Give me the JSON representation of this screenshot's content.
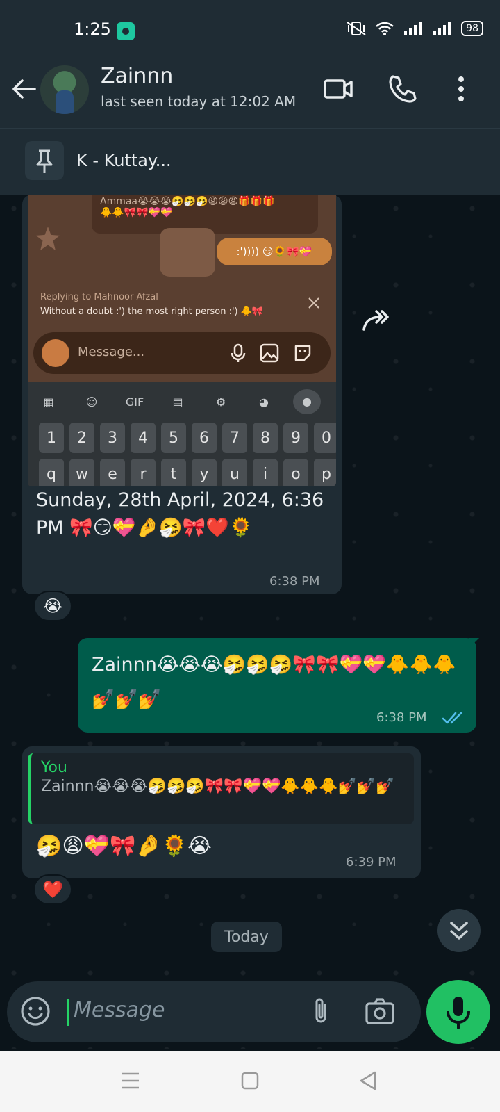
{
  "status": {
    "time": "1:25",
    "battery": "98"
  },
  "header": {
    "name": "Zainnn",
    "last_seen": "last seen today at 12:02 AM"
  },
  "pinned": {
    "text": "K - Kuttay..."
  },
  "shot": {
    "top_message": "Ammaa😭😭😭🤧🤧🤧😩😩😩🎁🎁🎁",
    "top_message_2": "🐥🐥🎀🎀💝💝",
    "bubble": ":')))) 😏🌻🎀💝",
    "reply_title": "Replying to Mahnoor Afzal",
    "reply_body": "Without a doubt :') the most right person :') 🐥🎀",
    "input_placeholder": "Message...",
    "gif_label": "GIF",
    "keys_row1": [
      "1",
      "2",
      "3",
      "4",
      "5",
      "6",
      "7",
      "8",
      "9",
      "0"
    ],
    "keys_row2": [
      "q",
      "w",
      "e",
      "r",
      "t",
      "y",
      "u",
      "i",
      "o",
      "p"
    ]
  },
  "messages": {
    "img_caption": "Sunday, 28th April, 2024, 6:36 PM 🎀😏💝🤌🤧🎀❤️🌻",
    "img_time": "6:38 PM",
    "img_reaction": "😭",
    "out_text": "Zainnn😭😭😭🤧🤧🤧🎀🎀💝💝🐥🐥🐥💅💅💅",
    "out_time": "6:38 PM",
    "quote_author": "You",
    "quote_text": "Zainnn😭😭😭🤧🤧🤧🎀🎀💝💝🐥🐥🐥💅💅💅",
    "reply_text": "🤧😩💝🎀🤌🌻😭",
    "reply_time": "6:39 PM",
    "reply_reaction": "❤️"
  },
  "date_chip": "Today",
  "input": {
    "placeholder": "Message"
  },
  "colors": {
    "accent": "#25d366",
    "outgoing": "#005c4b",
    "incoming": "#1f2c34",
    "background": "#0b141a"
  }
}
